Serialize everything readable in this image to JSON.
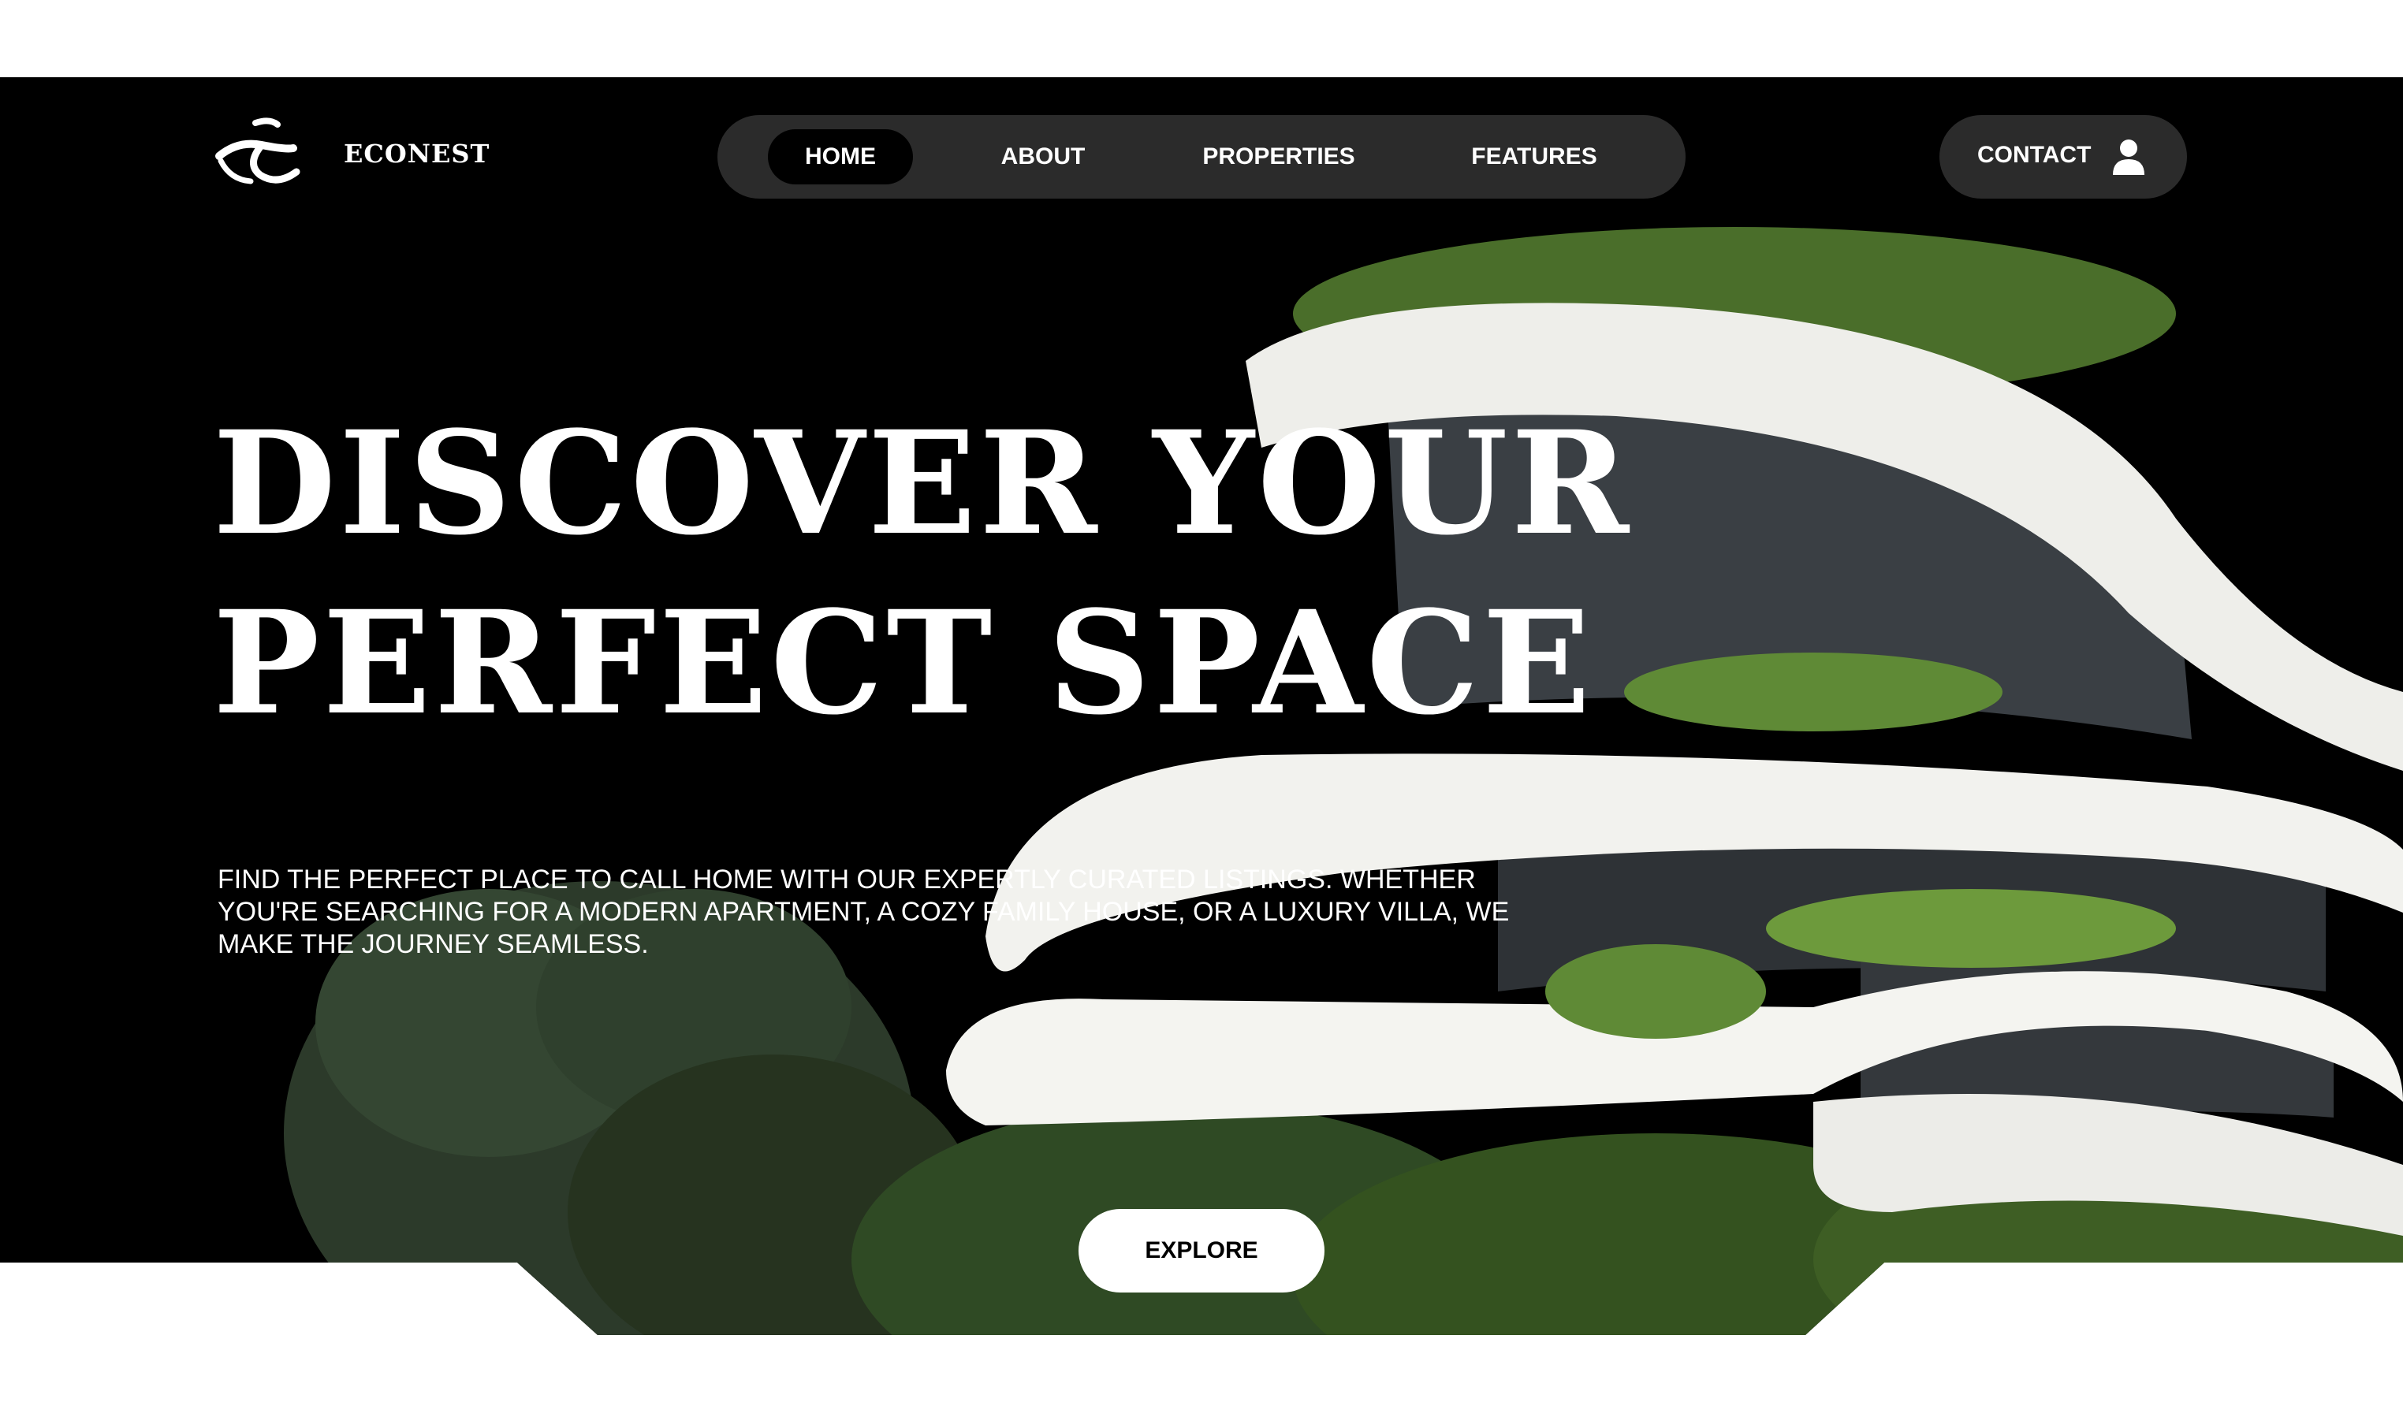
{
  "brand": {
    "name": "ECONEST"
  },
  "nav": {
    "items": [
      {
        "label": "HOME",
        "active": true
      },
      {
        "label": "ABOUT",
        "active": false
      },
      {
        "label": "PROPERTIES",
        "active": false
      },
      {
        "label": "FEATURES",
        "active": false
      }
    ]
  },
  "contact": {
    "label": "CONTACT",
    "icon": "user-icon"
  },
  "hero": {
    "title_line1": "DISCOVER YOUR",
    "title_line2": "PERFECT SPACE",
    "description": "FIND THE PERFECT PLACE TO CALL HOME WITH OUR EXPERTLY CURATED LISTINGS. WHETHER YOU'RE SEARCHING FOR A MODERN APARTMENT, A COZY FAMILY HOUSE, OR A LUXURY VILLA, WE MAKE THE JOURNEY SEAMLESS.",
    "cta_label": "EXPLORE"
  },
  "colors": {
    "background": "#000000",
    "pill": "#2b2b2b",
    "text": "#ffffff",
    "page": "#ffffff"
  }
}
